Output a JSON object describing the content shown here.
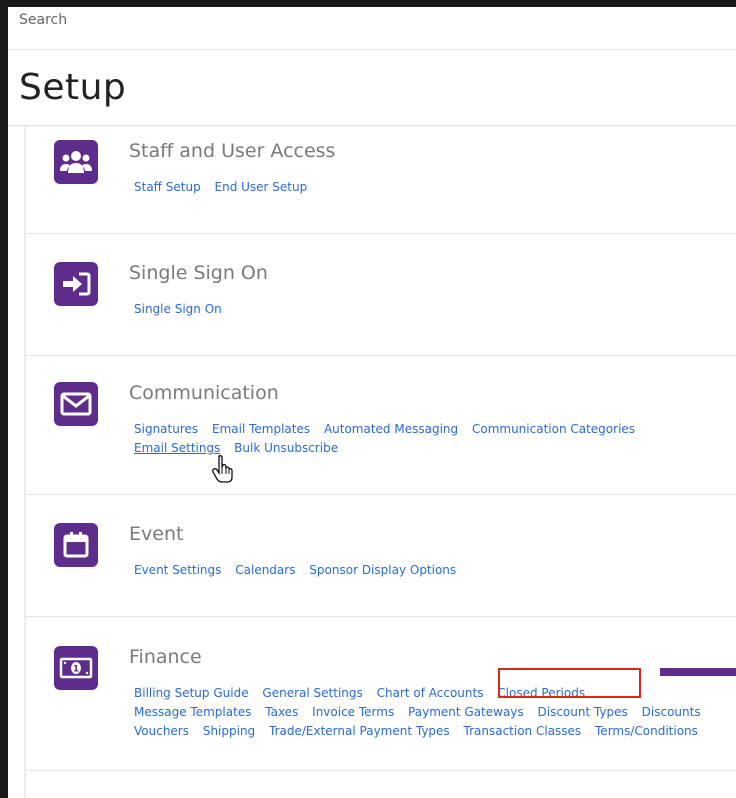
{
  "search": {
    "placeholder": "Search"
  },
  "page": {
    "title": "Setup"
  },
  "sections": [
    {
      "title": "Staff and User Access",
      "icon": "users-icon",
      "links": [
        "Staff Setup",
        "End User Setup"
      ]
    },
    {
      "title": "Single Sign On",
      "icon": "sign-in-icon",
      "links": [
        "Single Sign On"
      ]
    },
    {
      "title": "Communication",
      "icon": "envelope-icon",
      "links": [
        "Signatures",
        "Email Templates",
        "Automated Messaging",
        "Communication Categories",
        "Email Settings",
        "Bulk Unsubscribe"
      ]
    },
    {
      "title": "Event",
      "icon": "calendar-icon",
      "links": [
        "Event Settings",
        "Calendars",
        "Sponsor Display Options"
      ]
    },
    {
      "title": "Finance",
      "icon": "money-bill-icon",
      "links": [
        "Billing Setup Guide",
        "General Settings",
        "Chart of Accounts",
        "Closed Periods",
        "Message Templates",
        "Taxes",
        "Invoice Terms",
        "Payment Gateways",
        "Discount Types",
        "Discounts",
        "Vouchers",
        "Shipping",
        "Trade/External Payment Types",
        "Transaction Classes",
        "Terms/Conditions"
      ]
    }
  ],
  "colors": {
    "brand": "#5e2d8c",
    "link": "#2a6ad2",
    "highlight": "#e0241f"
  }
}
